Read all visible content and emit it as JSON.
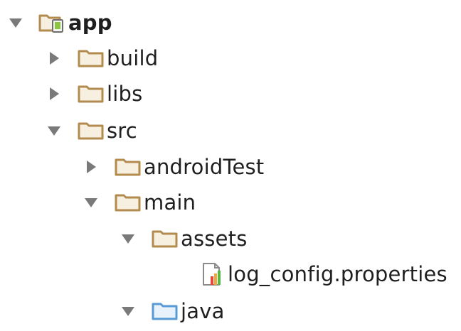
{
  "colors": {
    "folder": "#b38b4f",
    "folder_fill": "#f7efdf",
    "source_folder": "#5b9bd5",
    "source_folder_fill": "#e8f2fb",
    "arrow": "#7a7a7a",
    "module_green": "#8cc63f"
  },
  "tree": {
    "root": {
      "label": "app",
      "icon": "android-module-icon",
      "expanded": true
    },
    "build": {
      "label": "build",
      "icon": "folder-icon",
      "expanded": false
    },
    "libs": {
      "label": "libs",
      "icon": "folder-icon",
      "expanded": false
    },
    "src": {
      "label": "src",
      "icon": "folder-icon",
      "expanded": true
    },
    "androidTest": {
      "label": "androidTest",
      "icon": "folder-icon",
      "expanded": false
    },
    "main": {
      "label": "main",
      "icon": "folder-icon",
      "expanded": true
    },
    "assets": {
      "label": "assets",
      "icon": "folder-icon",
      "expanded": true
    },
    "log_config": {
      "label": "log_config.properties",
      "icon": "properties-file-icon"
    },
    "java": {
      "label": "java",
      "icon": "source-folder-icon",
      "expanded": true
    }
  }
}
